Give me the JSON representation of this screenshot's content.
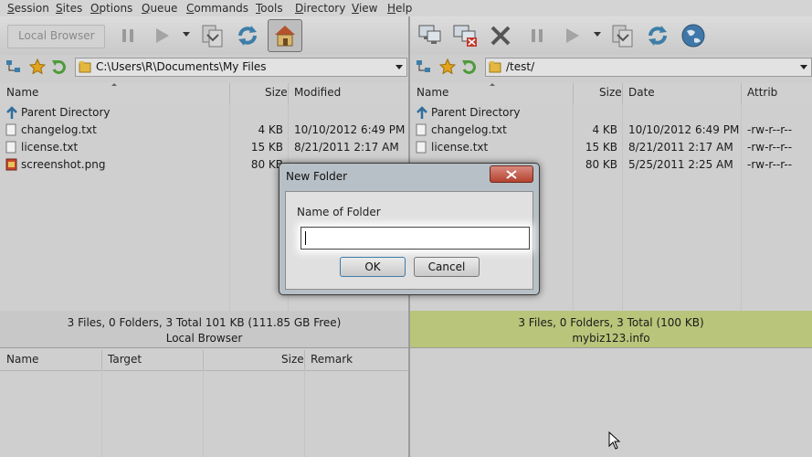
{
  "menu": [
    "Session",
    "Sites",
    "Options",
    "Queue",
    "Commands",
    "Tools",
    "Directory",
    "View",
    "Help"
  ],
  "local": {
    "toolbar_label": "Local Browser",
    "path": "C:\\Users\\R\\Documents\\My Files",
    "columns": [
      "Name",
      "Size",
      "Modified"
    ],
    "parent": "Parent Directory",
    "files": [
      {
        "name": "changelog.txt",
        "size": "4 KB",
        "date": "10/10/2012 6:49 PM",
        "icon": "text-file-icon"
      },
      {
        "name": "license.txt",
        "size": "15 KB",
        "date": "8/21/2011 2:17 AM",
        "icon": "text-file-icon"
      },
      {
        "name": "screenshot.png",
        "size": "80 KB",
        "date": "",
        "icon": "image-file-icon"
      }
    ],
    "status": "3 Files, 0 Folders, 3 Total 101 KB (111.85 GB Free)",
    "label": "Local Browser"
  },
  "remote": {
    "path": "/test/",
    "columns": [
      "Name",
      "Size",
      "Date",
      "Attrib"
    ],
    "parent": "Parent Directory",
    "files": [
      {
        "name": "changelog.txt",
        "size": "4 KB",
        "date": "10/10/2012 6:49 PM",
        "attrib": "-rw-r--r--"
      },
      {
        "name": "license.txt",
        "size": "15 KB",
        "date": "8/21/2011 2:17 AM",
        "attrib": "-rw-r--r--"
      },
      {
        "name": "",
        "size": "80 KB",
        "date": "5/25/2011 2:25 AM",
        "attrib": "-rw-r--r--"
      }
    ],
    "status": "3 Files, 0 Folders, 3 Total (100 KB)",
    "label": "mybiz123.info",
    "status_color": "#b9c57a"
  },
  "queue": {
    "columns": [
      "Name",
      "Target",
      "Size",
      "Remark"
    ]
  },
  "dialog": {
    "title": "New Folder",
    "label": "Name of Folder",
    "value": "",
    "ok": "OK",
    "cancel": "Cancel"
  }
}
